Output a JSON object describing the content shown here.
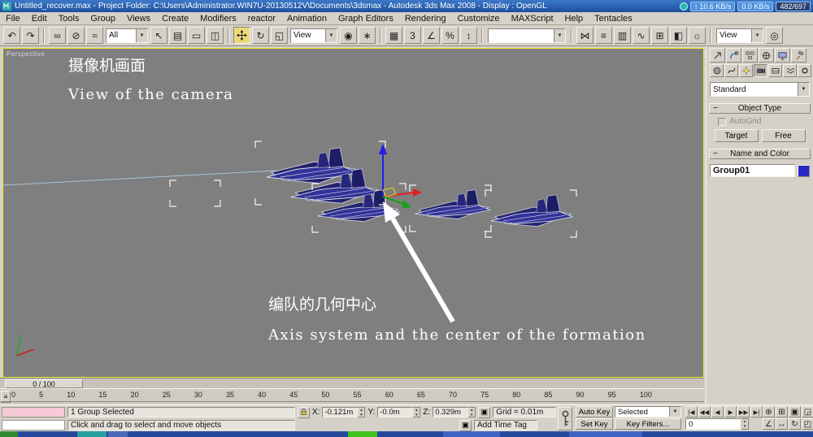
{
  "title_bar": {
    "title": "Untitled_recover.max    - Project Folder: C:\\Users\\Administrator.WIN7U-20130512V\\Documents\\3dsmax    - Autodesk 3ds Max 2008    - Display : OpenGL",
    "net_up": "10.6 KB/s",
    "net_down": "0.0 KB/s",
    "ratio": "482/697"
  },
  "menu": {
    "items": [
      "File",
      "Edit",
      "Tools",
      "Group",
      "Views",
      "Create",
      "Modifiers",
      "reactor",
      "Animation",
      "Graph Editors",
      "Rendering",
      "Customize",
      "MAXScript",
      "Help",
      "Tentacles"
    ]
  },
  "toolbar": {
    "filter": "All",
    "coord": "View",
    "named_sel": "",
    "render_type": "View"
  },
  "viewport": {
    "label": "Perspective",
    "note_cn_1": "摄像机画面",
    "note_en_1": "View of the camera",
    "note_cn_2": "编队的几何中心",
    "note_en_2": "Axis system and the center of the formation"
  },
  "timeline": {
    "slider": "0 / 100",
    "ticks": [
      "0",
      "5",
      "10",
      "15",
      "20",
      "25",
      "30",
      "35",
      "40",
      "45",
      "50",
      "55",
      "60",
      "65",
      "70",
      "75",
      "80",
      "85",
      "90",
      "95",
      "100"
    ]
  },
  "status": {
    "selection": "1 Group Selected",
    "prompt": "Click and drag to select and move objects",
    "x_label": "X:",
    "x": "-0.121m",
    "y_label": "Y:",
    "y": "-0.0m",
    "z_label": "Z:",
    "z": "0.329m",
    "grid": "Grid = 0.01m",
    "add_time_tag": "Add Time Tag"
  },
  "anim": {
    "auto_key": "Auto Key",
    "set_key": "Set Key",
    "key_mode": "Selected",
    "key_filters": "Key Filters...",
    "frame": "0"
  },
  "panel": {
    "preset": "Standard",
    "object_type": "Object Type",
    "autogrid": "AutoGrid",
    "target": "Target",
    "free": "Free",
    "name_color": "Name and Color",
    "object_name": "Group01"
  },
  "colors": {
    "viewport_bg": "#7f7f7f",
    "active_viewport_border": "#eded2e",
    "object_color": "#2828c8",
    "jet_fill": "#26267f",
    "annotation": "#ffffff"
  },
  "icons": {
    "undo": "↶",
    "redo": "↷",
    "link": "∞",
    "unlink": "⊘",
    "bind-spacewarp": "≈",
    "select": "↖",
    "select-by-name": "▤",
    "region": "▭",
    "window-crossing": "◫",
    "rotate": "↻",
    "scale": "◱",
    "use-center": "◉",
    "manipulate": "∗",
    "kbd-override": "▦",
    "snap-3d": "3",
    "snap-angle": "∠",
    "snap-percent": "%",
    "snap-spinner": "↕",
    "mirror": "⋈",
    "align": "≡",
    "layers": "▥",
    "curve-editor": "∿",
    "schematic": "⊞",
    "material-editor": "◧",
    "render-setup": "☼",
    "quick-render": "◎",
    "dd-arrow": "▼",
    "spin-up": "▲",
    "spin-down": "▼",
    "arrow-up": "↑",
    "go-start": "|◀",
    "prev-key": "◀◀",
    "prev-frame": "◀",
    "play": "▶",
    "next-frame": "▶▶",
    "go-end": "▶|",
    "zoom": "⊕",
    "zoom-all": "⊞",
    "zoom-extents": "▣",
    "zoom-extents-all": "◲",
    "pan": "↔",
    "arc-rotate": "↻",
    "max-toggle": "◰",
    "fov": "∠",
    "abs-offset": "▣",
    "mini-track": "≡",
    "collapse": "−"
  }
}
